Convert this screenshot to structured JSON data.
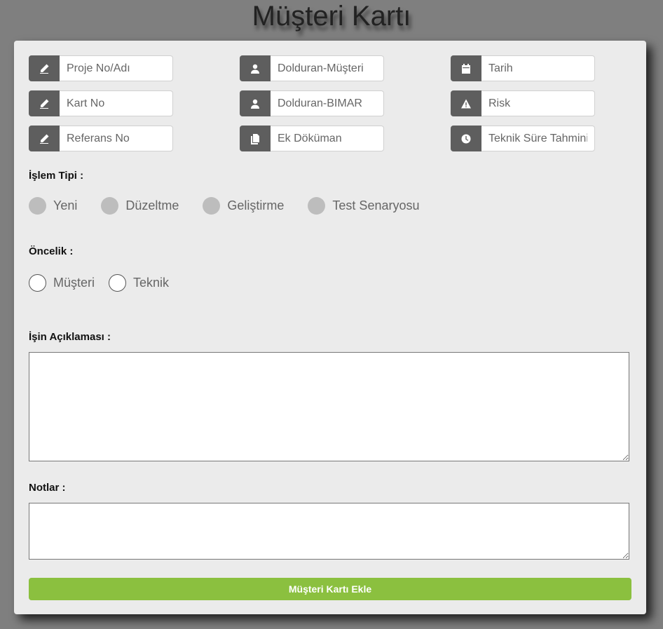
{
  "page": {
    "title": "Müşteri Kartı"
  },
  "fields": {
    "proje": {
      "placeholder": "Proje No/Adı",
      "icon": "pencil-icon"
    },
    "kart": {
      "placeholder": "Kart No",
      "icon": "pencil-icon"
    },
    "referans": {
      "placeholder": "Referans No",
      "icon": "pencil-icon"
    },
    "dolduran_musteri": {
      "placeholder": "Dolduran-Müşteri",
      "icon": "user-icon"
    },
    "dolduran_bimar": {
      "placeholder": "Dolduran-BIMAR",
      "icon": "user-icon"
    },
    "ek_dokuman": {
      "placeholder": "Ek Döküman",
      "icon": "document-icon"
    },
    "tarih": {
      "placeholder": "Tarih",
      "icon": "calendar-icon"
    },
    "risk": {
      "placeholder": "Risk",
      "icon": "warning-icon"
    },
    "teknik_sure": {
      "placeholder": "Teknik Süre Tahmini",
      "icon": "clock-icon"
    }
  },
  "islem_tipi": {
    "label": "İşlem Tipi :",
    "options": [
      "Yeni",
      "Düzeltme",
      "Geliştirme",
      "Test Senaryosu"
    ]
  },
  "oncelik": {
    "label": "Öncelik :",
    "options": [
      "Müşteri",
      "Teknik"
    ]
  },
  "aciklama": {
    "label": "İşin Açıklaması :",
    "value": ""
  },
  "notlar": {
    "label": "Notlar :",
    "value": ""
  },
  "submit": {
    "label": "Müşteri Kartı Ekle"
  },
  "colors": {
    "accent": "#8bc03f",
    "addon": "#5e5e5e",
    "card": "#ebebeb",
    "backdrop": "#7f7f7f"
  }
}
